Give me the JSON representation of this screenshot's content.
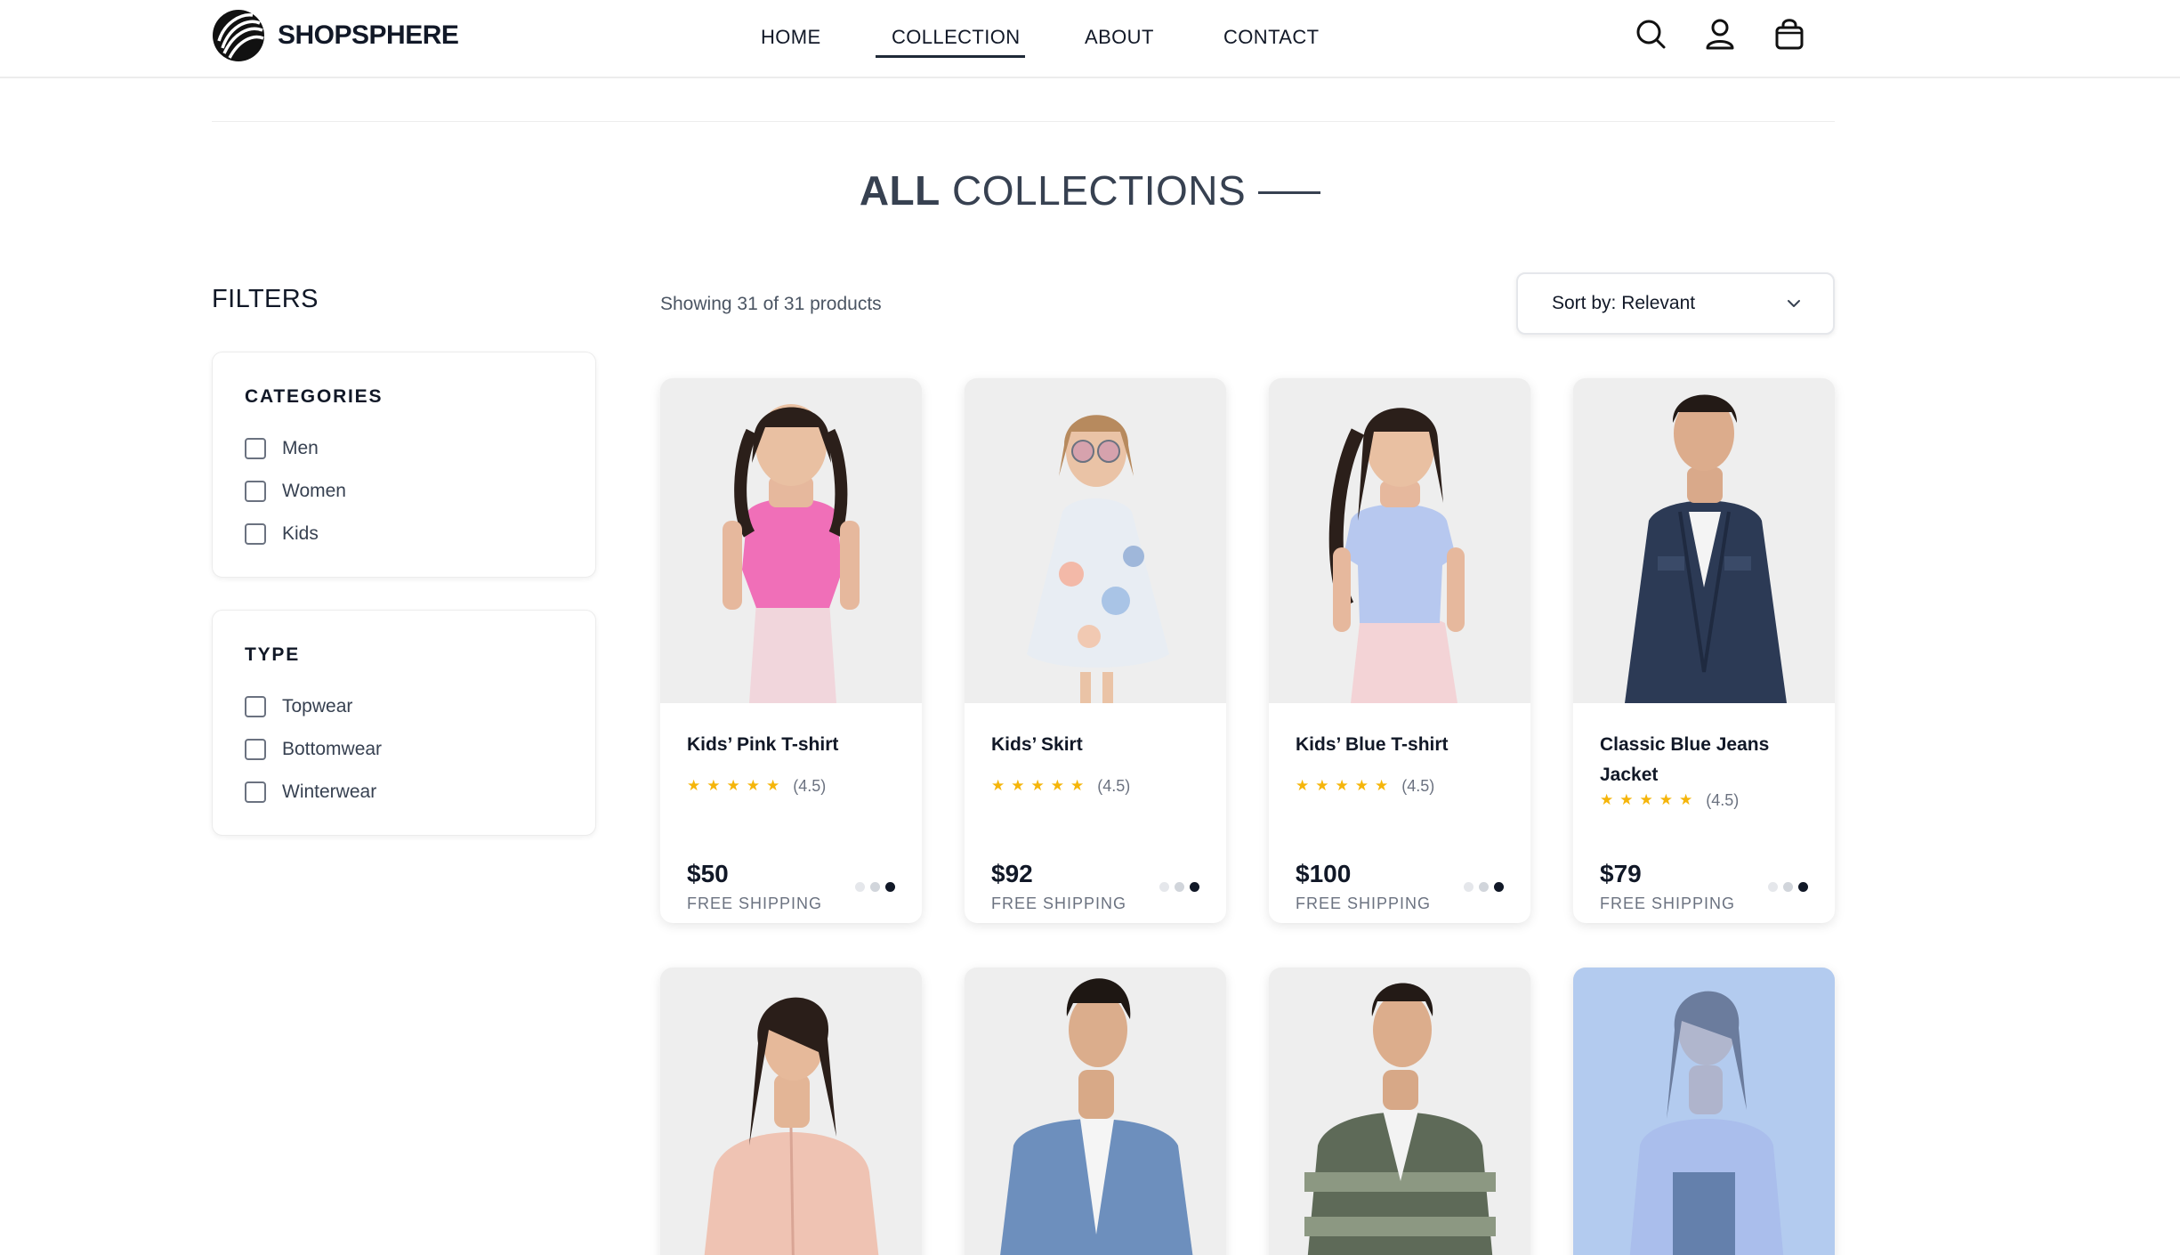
{
  "brand": {
    "name": "SHOPSPHERE"
  },
  "nav": {
    "items": [
      {
        "label": "HOME"
      },
      {
        "label": "COLLECTION",
        "active": true
      },
      {
        "label": "ABOUT"
      },
      {
        "label": "CONTACT"
      }
    ]
  },
  "header_icons": [
    "search-icon",
    "user-icon",
    "shopping-bag-icon"
  ],
  "page": {
    "title_strong": "ALL",
    "title_rest": "COLLECTIONS"
  },
  "filters": {
    "heading": "FILTERS",
    "categories": {
      "title": "CATEGORIES",
      "options": [
        "Men",
        "Women",
        "Kids"
      ]
    },
    "type": {
      "title": "TYPE",
      "options": [
        "Topwear",
        "Bottomwear",
        "Winterwear"
      ]
    }
  },
  "listing": {
    "count_text": "Showing 31 of 31 products",
    "sort_label": "Sort by: Relevant"
  },
  "colors": {
    "star": "#f5b50a",
    "text_dark": "#111827",
    "text_muted": "#6b7280"
  },
  "products": [
    {
      "name": "Kids’ Pink T-shirt",
      "rating_text": "(4.5)",
      "rating": 4.5,
      "price": "$50",
      "shipping": "FREE SHIPPING"
    },
    {
      "name": "Kids’ Skirt",
      "rating_text": "(4.5)",
      "rating": 4.5,
      "price": "$92",
      "shipping": "FREE SHIPPING"
    },
    {
      "name": "Kids’ Blue T-shirt",
      "rating_text": "(4.5)",
      "rating": 4.5,
      "price": "$100",
      "shipping": "FREE SHIPPING"
    },
    {
      "name": "Classic Blue Jeans Jacket",
      "rating_text": "(4.5)",
      "rating": 4.5,
      "price": "$79",
      "shipping": "FREE SHIPPING"
    }
  ]
}
